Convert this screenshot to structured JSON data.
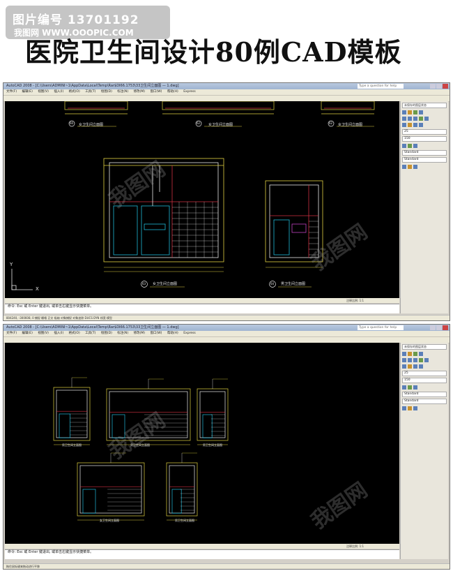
{
  "stamp": {
    "id_text": "图片编号 13701192",
    "site_text": "我图网 WWW.OOOPIC.COM"
  },
  "page_title": "医院卫生间设计80例CAD模板",
  "window1": {
    "title": "AutoCAD 2008 - [C:\\Users\\ADMINI~1\\AppData\\Local\\Temp\\Rar$DI66.1753\\33卫生间立面图 — 1.dwg]",
    "help_placeholder": "Type a question for help",
    "menus": [
      "文件(F)",
      "编辑(E)",
      "视图(V)",
      "插入(I)",
      "格式(O)",
      "工具(T)",
      "绘图(D)",
      "标注(N)",
      "修改(M)",
      "窗口(W)",
      "帮助(H)",
      "Express"
    ],
    "workspace": "二维草图与注释",
    "drawings": {
      "top_labels": [
        "女卫生间立面图",
        "女卫生间立面图",
        "女卫生间立面图"
      ],
      "top_numbers": [
        "60",
        "62",
        "62"
      ],
      "main_left_label": "女卫生间立面图",
      "main_left_number": "63",
      "main_right_label": "男卫生间立面图",
      "main_right_number": "64",
      "axis_x": "X",
      "axis_y": "Y"
    },
    "layout_scale": "注释比例: 1:1",
    "command_text": "命令: Esc 或 Enter 键退出, 或单击右键显示快捷菜单。",
    "status_text": "804240, -300608, 0    捕捉 栅格 正交 极轴 对象捕捉 对象追踪 DUCS DYN 线宽 模型",
    "panel": {
      "layer_title": "未保存的图层状态",
      "field1": "25",
      "field2": "150",
      "style1": "Standard",
      "style2": "Standard"
    }
  },
  "window2": {
    "title": "AutoCAD 2008 - [C:\\Users\\ADMINI~1\\AppData\\Local\\Temp\\Rar$DI66.1753\\33卫生间立面图 — 1.dwg]",
    "help_placeholder": "Type a question for help",
    "menus": [
      "文件(F)",
      "编辑(E)",
      "视图(V)",
      "插入(I)",
      "格式(O)",
      "工具(T)",
      "绘图(D)",
      "标注(N)",
      "修改(M)",
      "窗口(W)",
      "帮助(H)",
      "Express"
    ],
    "workspace": "二维草图与注释",
    "drawings": {
      "labels": [
        "男卫生间立面图",
        "男卫生间立面图",
        "男卫生间立面图",
        "女卫生间立面图",
        "男卫生间立面图"
      ]
    },
    "layout_scale": "注释比例: 1:1",
    "command_text": "命令: Esc 或 Enter 键退出, 或单击右键显示快捷菜单。",
    "status_text": "拖住鼠标键来拖动进行平移",
    "panel": {
      "layer_title": "未保存的图层状态",
      "field1": "25",
      "field2": "150",
      "style1": "Standard",
      "style2": "Standard"
    }
  },
  "colors": {
    "canvas": "#000000",
    "cad_yellow": "#e0d040",
    "cad_cyan": "#20b8d8",
    "cad_red": "#d03040",
    "cad_white": "#e8e8e8",
    "cad_magenta": "#c040c0"
  }
}
